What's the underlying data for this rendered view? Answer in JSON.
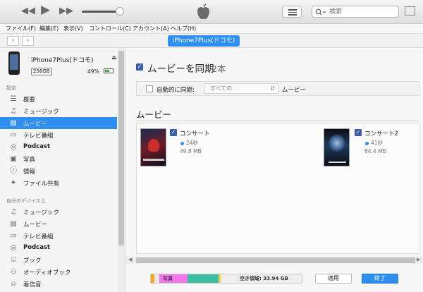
{
  "menu": [
    "ファイル(F)",
    "編集(E)",
    "表示(V)",
    "コントロール(C)",
    "アカウント(A)",
    "ヘルプ(H)"
  ],
  "search": {
    "placeholder": "検索"
  },
  "device": {
    "pill": "iPhone7Plus(ドコモ)",
    "name": "iPhone7Plus(ドコモ)",
    "capacity": "256GB",
    "battery": "49%",
    "battery_level": 0.49
  },
  "sidebar": {
    "settings_header": "設定",
    "settings": [
      {
        "label": "概要",
        "icon": "summary-icon"
      },
      {
        "label": "ミュージック",
        "icon": "music-note-icon"
      },
      {
        "label": "ムービー",
        "icon": "film-icon",
        "selected": true
      },
      {
        "label": "テレビ番組",
        "icon": "tv-icon"
      },
      {
        "label": "Podcast",
        "icon": "podcast-icon",
        "bold": true
      },
      {
        "label": "写真",
        "icon": "camera-icon"
      },
      {
        "label": "情報",
        "icon": "info-icon"
      },
      {
        "label": "ファイル共有",
        "icon": "apps-icon"
      }
    ],
    "ondevice_header": "自分のデバイス上",
    "ondevice": [
      {
        "label": "ミュージック",
        "icon": "music-note-icon"
      },
      {
        "label": "ムービー",
        "icon": "film-icon"
      },
      {
        "label": "テレビ番組",
        "icon": "tv-icon"
      },
      {
        "label": "Podcast",
        "icon": "podcast-icon",
        "bold": true
      },
      {
        "label": "ブック",
        "icon": "book-icon"
      },
      {
        "label": "オーディオブック",
        "icon": "audiobook-icon"
      },
      {
        "label": "着信音",
        "icon": "bell-icon"
      }
    ]
  },
  "main": {
    "sync_label": "ムービーを同期",
    "sync_count": "2本",
    "auto_label": "自動的に同期:",
    "auto_select": "すべての",
    "auto_tail": "ムービー",
    "movies_heading": "ムービー",
    "movies": [
      {
        "title": "コンサート",
        "duration": "24秒",
        "size": "49.8 MB"
      },
      {
        "title": "コンサート2",
        "duration": "41秒",
        "size": "84.4 MB"
      }
    ]
  },
  "footer": {
    "photos_label": "写真",
    "free_label": "空き領域: 33.94 GB",
    "apply": "適用",
    "done": "終了"
  },
  "colors": {
    "accent": "#2e8ff0",
    "seg_orange": "#f5a623",
    "seg_photos": "#f277e8",
    "seg_apps": "#3bbfa3",
    "seg_yellow": "#f2d34a"
  }
}
